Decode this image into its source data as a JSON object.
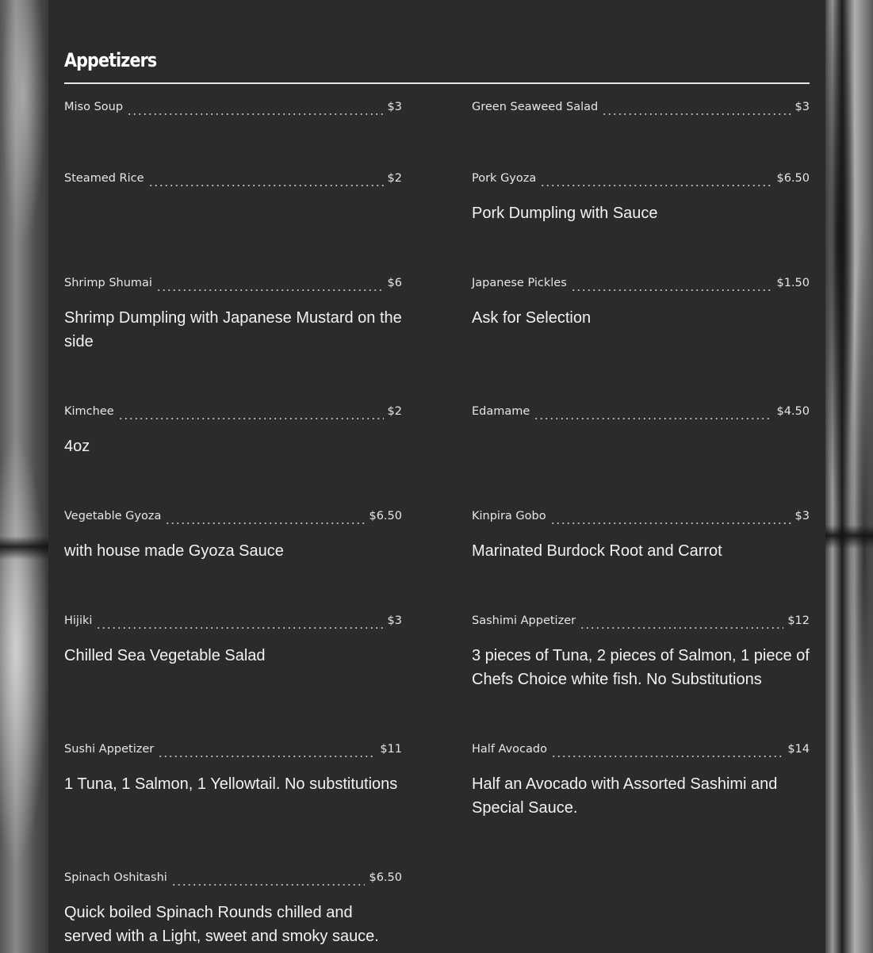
{
  "section": {
    "title": "Appetizers"
  },
  "items": [
    {
      "name": "Miso Soup",
      "price": "$3",
      "description": ""
    },
    {
      "name": "Green Seaweed Salad",
      "price": "$3",
      "description": ""
    },
    {
      "name": "Steamed Rice",
      "price": "$2",
      "description": ""
    },
    {
      "name": "Pork Gyoza",
      "price": "$6.50",
      "description": "Pork Dumpling with Sauce"
    },
    {
      "name": "Shrimp Shumai",
      "price": "$6",
      "description": "Shrimp Dumpling with Japanese Mustard on the side"
    },
    {
      "name": "Japanese Pickles",
      "price": "$1.50",
      "description": "Ask for Selection"
    },
    {
      "name": "Kimchee",
      "price": "$2",
      "description": "4oz"
    },
    {
      "name": "Edamame",
      "price": "$4.50",
      "description": ""
    },
    {
      "name": "Vegetable Gyoza",
      "price": "$6.50",
      "description": "with house made Gyoza Sauce"
    },
    {
      "name": "Kinpira Gobo",
      "price": "$3",
      "description": "Marinated Burdock Root and Carrot"
    },
    {
      "name": "Hijiki",
      "price": "$3",
      "description": "Chilled Sea Vegetable Salad"
    },
    {
      "name": "Sashimi Appetizer",
      "price": "$12",
      "description": "3 pieces of Tuna, 2 pieces of Salmon, 1 piece of Chefs Choice white fish. No Substitutions"
    },
    {
      "name": "Sushi Appetizer",
      "price": "$11",
      "description": "1 Tuna, 1 Salmon, 1 Yellowtail. No substitutions"
    },
    {
      "name": "Half Avocado",
      "price": "$14",
      "description": "Half an Avocado with Assorted Sashimi and Special Sauce."
    },
    {
      "name": "Spinach Oshitashi",
      "price": "$6.50",
      "description": "Quick boiled Spinach Rounds chilled and served with a Light, sweet and smoky sauce."
    }
  ]
}
